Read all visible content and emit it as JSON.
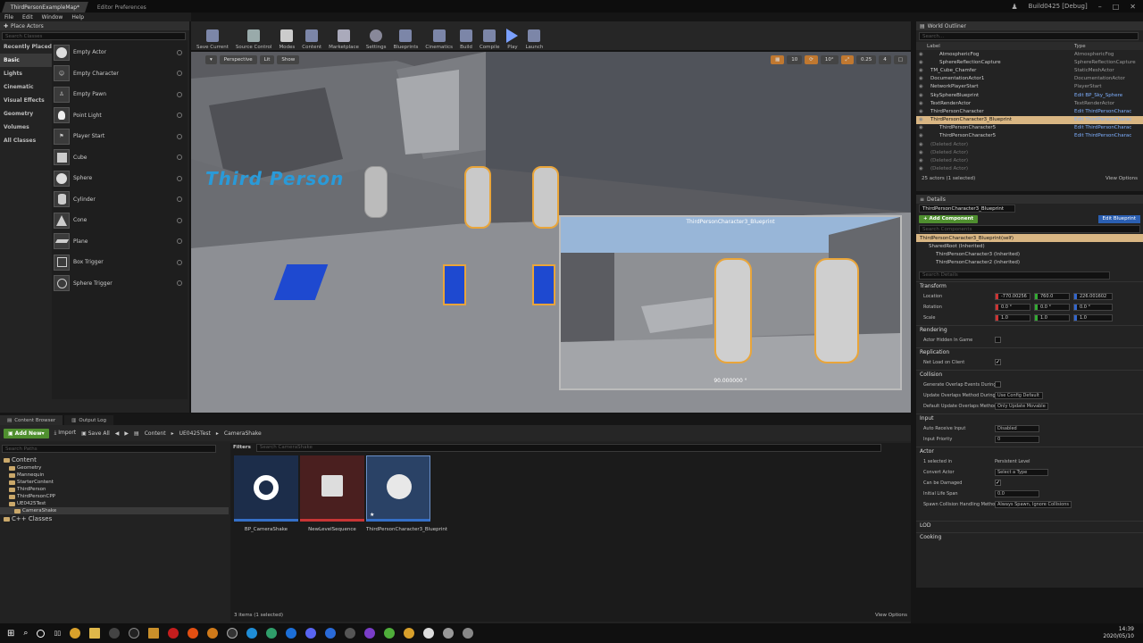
{
  "window": {
    "tabs": [
      "ThirdPersonExampleMap*",
      "Editor Preferences"
    ],
    "app_title": "Build0425 [Debug]",
    "menu": [
      "File",
      "Edit",
      "Window",
      "Help"
    ]
  },
  "place_actors": {
    "title": "Place Actors",
    "search_placeholder": "Search Classes",
    "categories": [
      "Recently Placed",
      "Basic",
      "Lights",
      "Cinematic",
      "Visual Effects",
      "Geometry",
      "Volumes",
      "All Classes"
    ],
    "items": [
      "Empty Actor",
      "Empty Character",
      "Empty Pawn",
      "Point Light",
      "Player Start",
      "Cube",
      "Sphere",
      "Cylinder",
      "Cone",
      "Plane",
      "Box Trigger",
      "Sphere Trigger"
    ]
  },
  "toolbar": {
    "buttons": [
      "Save Current",
      "Source Control",
      "Modes",
      "Content",
      "Marketplace",
      "Settings",
      "Blueprints",
      "Cinematics",
      "Build",
      "Compile",
      "Play",
      "Launch"
    ]
  },
  "viewport": {
    "perspective": "Perspective",
    "lit": "Lit",
    "show": "Show",
    "snap_values": [
      "10",
      "10°",
      "0.25",
      "4"
    ],
    "floor_text": "Third Person",
    "pip_title": "ThirdPersonCharacter3_Blueprint",
    "pip_fov": "90.000000 °"
  },
  "outliner": {
    "title": "World Outliner",
    "search_placeholder": "Search...",
    "col_label": "Label",
    "col_type": "Type",
    "rows": [
      {
        "label": "AtmosphericFog",
        "type": "AtmosphericFog",
        "indent": 2,
        "sel": false,
        "del": false,
        "link": false
      },
      {
        "label": "SphereReflectionCapture",
        "type": "SphereReflectionCapture",
        "indent": 2,
        "sel": false,
        "del": false,
        "link": false
      },
      {
        "label": "TM_Cube_Chamfer",
        "type": "StaticMeshActor",
        "indent": 1,
        "sel": false,
        "del": false,
        "link": false
      },
      {
        "label": "DocumentationActor1",
        "type": "DocumentationActor",
        "indent": 1,
        "sel": false,
        "del": false,
        "link": false
      },
      {
        "label": "NetworkPlayerStart",
        "type": "PlayerStart",
        "indent": 1,
        "sel": false,
        "del": false,
        "link": false
      },
      {
        "label": "SkySphereBlueprint",
        "type": "Edit BP_Sky_Sphere",
        "indent": 1,
        "sel": false,
        "del": false,
        "link": true
      },
      {
        "label": "TextRenderActor",
        "type": "TextRenderActor",
        "indent": 1,
        "sel": false,
        "del": false,
        "link": false
      },
      {
        "label": "ThirdPersonCharacter",
        "type": "Edit ThirdPersonCharac",
        "indent": 1,
        "sel": false,
        "del": false,
        "link": true
      },
      {
        "label": "ThirdPersonCharacter3_Blueprint",
        "type": "Edit ThirdPersonCharac",
        "indent": 1,
        "sel": true,
        "del": false,
        "link": true
      },
      {
        "label": "ThirdPersonCharacter5",
        "type": "Edit ThirdPersonCharac",
        "indent": 2,
        "sel": false,
        "del": false,
        "link": true
      },
      {
        "label": "ThirdPersonCharacter5",
        "type": "Edit ThirdPersonCharac",
        "indent": 2,
        "sel": false,
        "del": false,
        "link": true
      },
      {
        "label": "(Deleted Actor)",
        "type": "",
        "indent": 1,
        "sel": false,
        "del": true,
        "link": false
      },
      {
        "label": "(Deleted Actor)",
        "type": "",
        "indent": 1,
        "sel": false,
        "del": true,
        "link": false
      },
      {
        "label": "(Deleted Actor)",
        "type": "",
        "indent": 1,
        "sel": false,
        "del": true,
        "link": false
      },
      {
        "label": "(Deleted Actor)",
        "type": "",
        "indent": 1,
        "sel": false,
        "del": true,
        "link": false
      }
    ],
    "status": "25 actors (1 selected)",
    "view_options": "View Options"
  },
  "details": {
    "title": "Details",
    "name_value": "ThirdPersonCharacter3_Blueprint",
    "add_component": "+ Add Component",
    "edit_blueprint": "Edit Blueprint",
    "search_components": "Search Components",
    "components": [
      "ThirdPersonCharacter3_Blueprint(self)",
      "SharedRoot (Inherited)",
      "ThirdPersonCharacter3 (Inherited)",
      "ThirdPersonCharacter2 (Inherited)"
    ],
    "search_details": "Search Details",
    "transform": {
      "title": "Transform",
      "location_label": "Location",
      "rotation_label": "Rotation",
      "scale_label": "Scale",
      "location": [
        "-770.00256",
        "760.0",
        "226.001602"
      ],
      "rotation": [
        "0.0 °",
        "0.0 °",
        "0.0 °"
      ],
      "scale": [
        "1.0",
        "1.0",
        "1.0"
      ]
    },
    "rendering": {
      "title": "Rendering",
      "hidden": "Actor Hidden In Game"
    },
    "replication": {
      "title": "Replication",
      "net_load": "Net Load on Client"
    },
    "collision": {
      "title": "Collision",
      "gen_overlap": "Generate Overlap Events During",
      "update_method": "Update Overlaps Method During",
      "update_method_val": "Use Config Default",
      "default_method": "Default Update Overlaps Method",
      "default_method_val": "Only Update Movable"
    },
    "input": {
      "title": "Input",
      "auto_receive": "Auto Receive Input",
      "auto_receive_val": "Disabled",
      "priority": "Input Priority",
      "priority_val": "0"
    },
    "actor": {
      "title": "Actor",
      "selected_in": "1 selected in",
      "selected_in_val": "Persistent Level",
      "convert": "Convert Actor",
      "convert_val": "Select a Type",
      "damaged": "Can be Damaged",
      "lifespan": "Initial Life Span",
      "lifespan_val": "0.0",
      "spawn": "Spawn Collision Handling Metho",
      "spawn_val": "Always Spawn, Ignore Collisions"
    },
    "lod": "LOD",
    "cooking": "Cooking"
  },
  "content_browser": {
    "tabs": [
      "Content Browser",
      "Output Log"
    ],
    "add_new": "Add New",
    "import": "Import",
    "save_all": "Save All",
    "path": [
      "Content",
      "UE0425Test",
      "CameraShake"
    ],
    "search_paths": "Search Paths",
    "filters": "Filters",
    "search_asset": "Search CameraShake",
    "tree": [
      {
        "name": "Content",
        "indent": 0,
        "sel": false
      },
      {
        "name": "Geometry",
        "indent": 1,
        "sel": false
      },
      {
        "name": "Mannequin",
        "indent": 1,
        "sel": false
      },
      {
        "name": "StarterContent",
        "indent": 1,
        "sel": false
      },
      {
        "name": "ThirdPerson",
        "indent": 1,
        "sel": false
      },
      {
        "name": "ThirdPersonCPP",
        "indent": 1,
        "sel": false
      },
      {
        "name": "UE0425Test",
        "indent": 1,
        "sel": false
      },
      {
        "name": "CameraShake",
        "indent": 2,
        "sel": true
      },
      {
        "name": "C++ Classes",
        "indent": 0,
        "sel": false
      }
    ],
    "assets": [
      "BP_CameraShake",
      "NewLevelSequence",
      "ThirdPersonCharacter3_Blueprint"
    ],
    "status": "3 items (1 selected)",
    "view_options": "View Options"
  },
  "taskbar": {
    "time": "14:39",
    "date": "2020/05/10"
  }
}
